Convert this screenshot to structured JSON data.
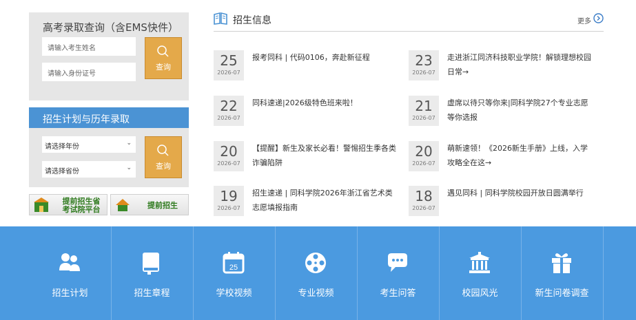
{
  "query": {
    "title": "高考录取查询（含EMS快件）",
    "name_placeholder": "请输入考生姓名",
    "id_placeholder": "请输入身份证号",
    "button": "查询"
  },
  "plan": {
    "title": "招生计划与历年录取",
    "year_select": "请选择年份",
    "province_select": "请选择省份",
    "button": "查询"
  },
  "banners": [
    {
      "line1": "提前招生省",
      "line2": "考试院平台"
    },
    {
      "line1": "提前招生",
      "line2": ""
    }
  ],
  "news": {
    "title": "招生信息",
    "more": "更多",
    "items": [
      {
        "day": "25",
        "month": "2026-07",
        "text": "报考同科 | 代码0106，奔赴新征程"
      },
      {
        "day": "23",
        "month": "2026-07",
        "text": "走进浙江同济科技职业学院！解锁理想校园日常→"
      },
      {
        "day": "22",
        "month": "2026-07",
        "text": "同科速递|2026级特色班来啦！"
      },
      {
        "day": "21",
        "month": "2026-07",
        "text": "虚席以待只等你来|同科学院27个专业志愿等你选报"
      },
      {
        "day": "20",
        "month": "2026-07",
        "text": "【提醒】新生及家长必看！警惕招生季各类诈骗陷阱"
      },
      {
        "day": "20",
        "month": "2026-07",
        "text": "萌新速领！《2026新生手册》上线，入学攻略全在这→"
      },
      {
        "day": "19",
        "month": "2026-07",
        "text": "招生速递 | 同科学院2026年浙江省艺术类志愿填报指南"
      },
      {
        "day": "18",
        "month": "2026-07",
        "text": "遇见同科 | 同科学院校园开放日圆满举行"
      }
    ]
  },
  "nav": [
    {
      "label": "招生计划",
      "icon": "people-icon"
    },
    {
      "label": "招生章程",
      "icon": "book-icon"
    },
    {
      "label": "学校视频",
      "icon": "calendar-icon",
      "badge": "25"
    },
    {
      "label": "专业视频",
      "icon": "film-reel-icon"
    },
    {
      "label": "考生问答",
      "icon": "chat-icon"
    },
    {
      "label": "校园风光",
      "icon": "building-icon"
    },
    {
      "label": "新生问卷调查",
      "icon": "gift-icon"
    }
  ],
  "colors": {
    "accent_blue": "#4b9ae0",
    "button_orange": "#e4a94a",
    "banner_green": "#2e7a1d"
  }
}
